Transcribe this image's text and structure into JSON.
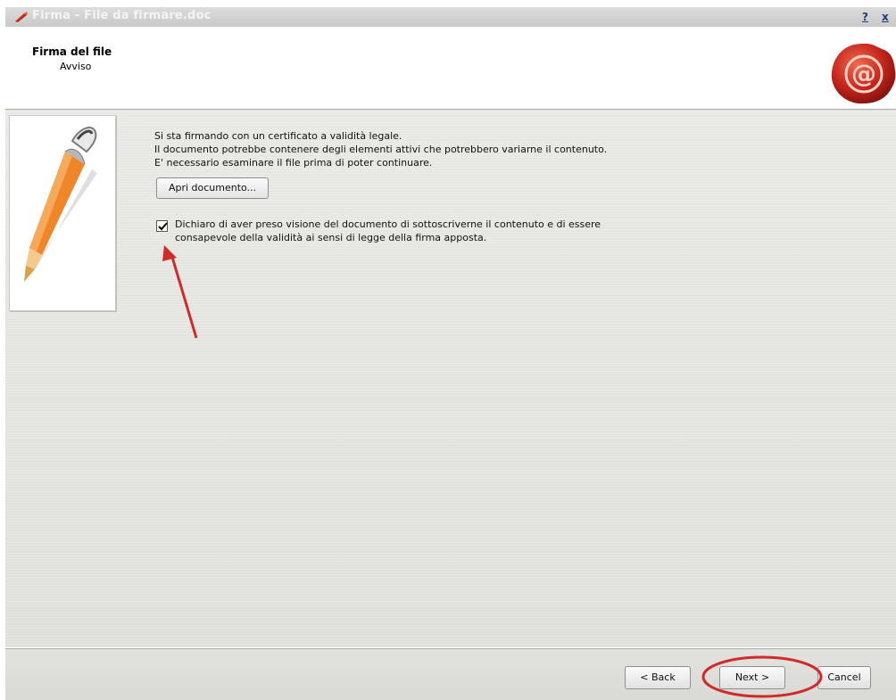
{
  "window": {
    "title": "Firma - File da firmare.doc",
    "help_label": "?",
    "close_label": "x"
  },
  "header": {
    "title": "Firma del file",
    "subtitle": "Avviso"
  },
  "main": {
    "info_lines": [
      "Si sta firmando con un certificato a validità legale.",
      "Il documento potrebbe contenere degli elementi attivi che potrebbero variarne il contenuto.",
      "E' necessario esaminare il file prima di poter continuare."
    ],
    "open_document_label": "Apri documento...",
    "declaration": {
      "checked": true,
      "lines": [
        "Dichiaro di aver preso visione del documento di sottoscriverne il contenuto e di essere",
        "consapevole della validità ai sensi di legge della firma apposta."
      ]
    }
  },
  "footer": {
    "back_label": "< Back",
    "next_label": "Next >",
    "cancel_label": "Cancel"
  },
  "colors": {
    "annotation_red": "#d02a2a",
    "seal_red": "#c8281e",
    "pen_orange": "#f0862a"
  },
  "icons": {
    "app": "signature-pen-icon",
    "seal": "wax-seal-at-icon",
    "illustration": "pen-illustration",
    "check": "checkmark-icon"
  }
}
